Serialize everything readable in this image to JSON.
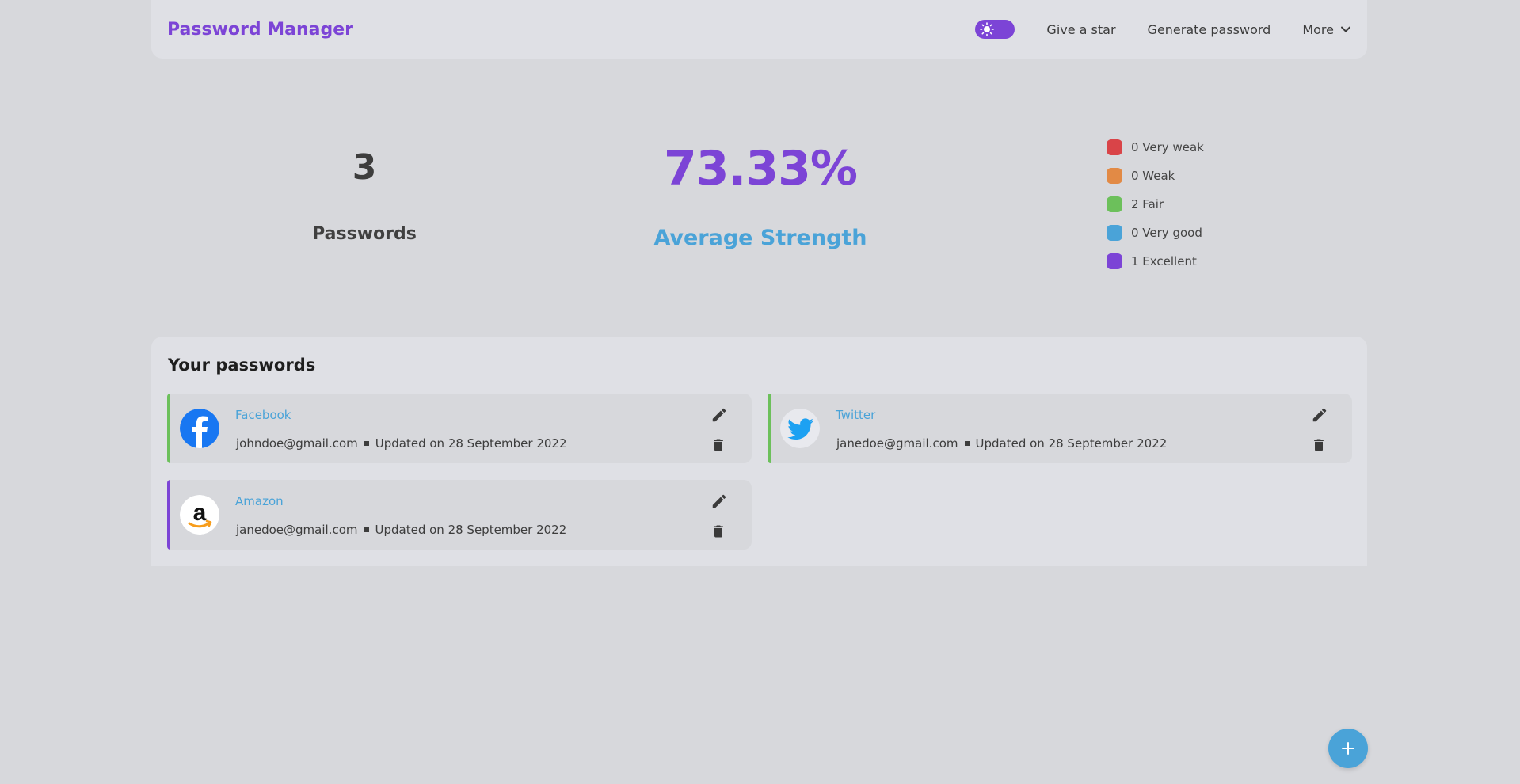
{
  "navbar": {
    "brand": "Password Manager",
    "links": [
      "Give a star",
      "Generate password"
    ],
    "more_label": "More"
  },
  "stats": {
    "password_count": "3",
    "password_count_label": "Passwords",
    "average_strength": "73.33%",
    "average_strength_label": "Average Strength"
  },
  "legend": [
    {
      "text": "0 Very weak",
      "color": "#d94448"
    },
    {
      "text": "0 Weak",
      "color": "#e28a45"
    },
    {
      "text": "2 Fair",
      "color": "#6cc05b"
    },
    {
      "text": "0 Very good",
      "color": "#4aa3d8"
    },
    {
      "text": "1 Excellent",
      "color": "#7c44d6"
    }
  ],
  "passwords": {
    "title": "Your passwords",
    "items": [
      {
        "name": "Facebook",
        "email": "johndoe@gmail.com",
        "updated": "Updated on 28 September 2022",
        "logo": "facebook-logo"
      },
      {
        "name": "Twitter",
        "email": "janedoe@gmail.com",
        "updated": "Updated on 28 September 2022",
        "logo": "twitter-logo"
      },
      {
        "name": "Amazon",
        "email": "janedoe@gmail.com",
        "updated": "Updated on 28 September 2022",
        "logo": "amazon-logo"
      }
    ]
  },
  "colors": {
    "accent_purple": "#7c44d6",
    "accent_blue": "#4aa3d8",
    "fair_green": "#6cc05b"
  },
  "icons": [
    "sun-icon",
    "chevron-down-icon",
    "edit-icon",
    "trash-icon",
    "plus-icon"
  ]
}
